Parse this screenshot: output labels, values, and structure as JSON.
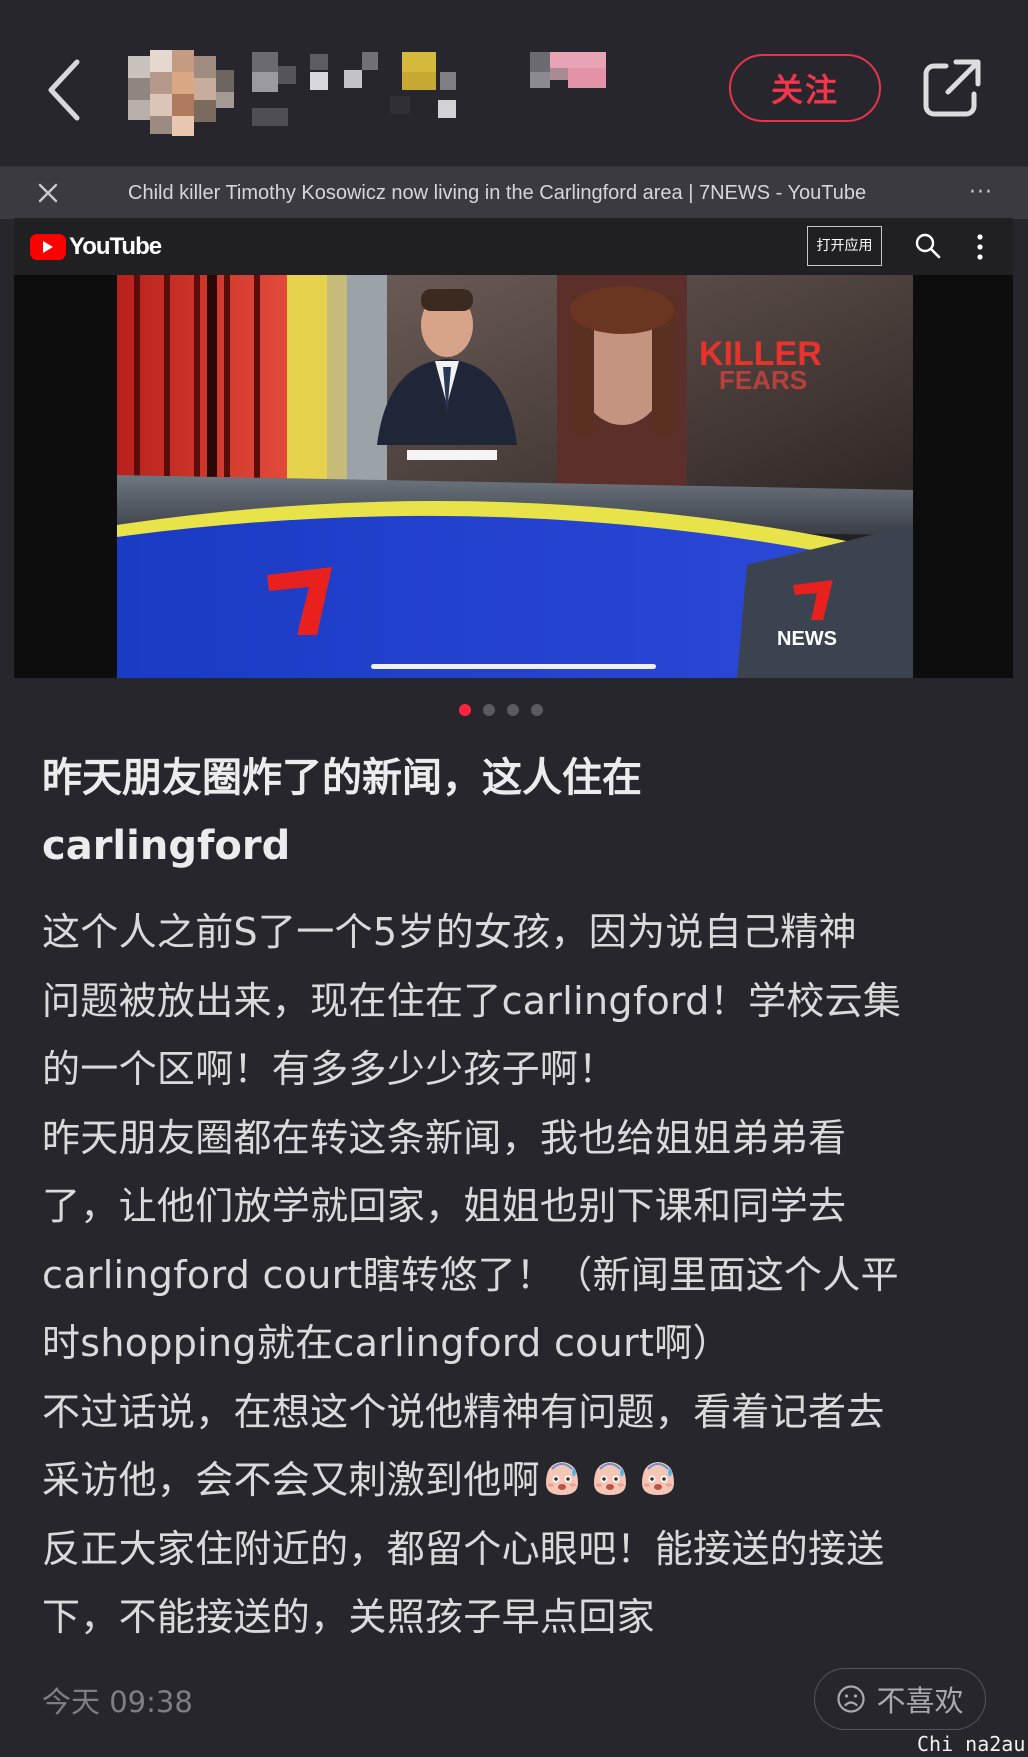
{
  "header": {
    "follow_label": "关注"
  },
  "link_bar": {
    "title": "Child killer Timothy Kosowicz now living in the Carlingford area | 7NEWS - YouTube",
    "more_label": "···"
  },
  "youtube": {
    "brand": "YouTube",
    "open_app_label": "打开应用",
    "video_overlay_text": "KILLER",
    "video_overlay_text_2": "FEARS",
    "channel_logo_text": "NEWS"
  },
  "carousel": {
    "count": 4,
    "active_index": 0
  },
  "post": {
    "title_lines": [
      "昨天朋友圈炸了的新闻，这人住在",
      "carlingford"
    ],
    "body_lines": [
      "这个人之前S了一个5岁的女孩，因为说自己精神",
      "问题被放出来，现在住在了carlingford！学校云集",
      "的一个区啊！有多多少少孩子啊！",
      "昨天朋友圈都在转这条新闻，我也给姐姐弟弟看",
      "了，让他们放学就回家，姐姐也别下课和同学去",
      "carlingford court瞎转悠了！（新闻里面这个人平",
      "时shopping就在carlingford court啊）",
      "不过话说，在想这个说他精神有问题，看着记者去",
      "采访他，会不会又刺激到他啊",
      "反正大家住附近的，都留个心眼吧！能接送的接送",
      "下，不能接送的，关照孩子早点回家"
    ],
    "emoji_names": [
      "sweat-face-emoji",
      "sweat-face-emoji",
      "sweat-face-emoji"
    ]
  },
  "footer": {
    "time": "今天 09:38",
    "dislike_label": "不喜欢"
  },
  "watermark": "Chi na2au",
  "colors": {
    "background": "#26262c",
    "accent_red": "#ff2442",
    "link_bar": "#3a3a40"
  }
}
